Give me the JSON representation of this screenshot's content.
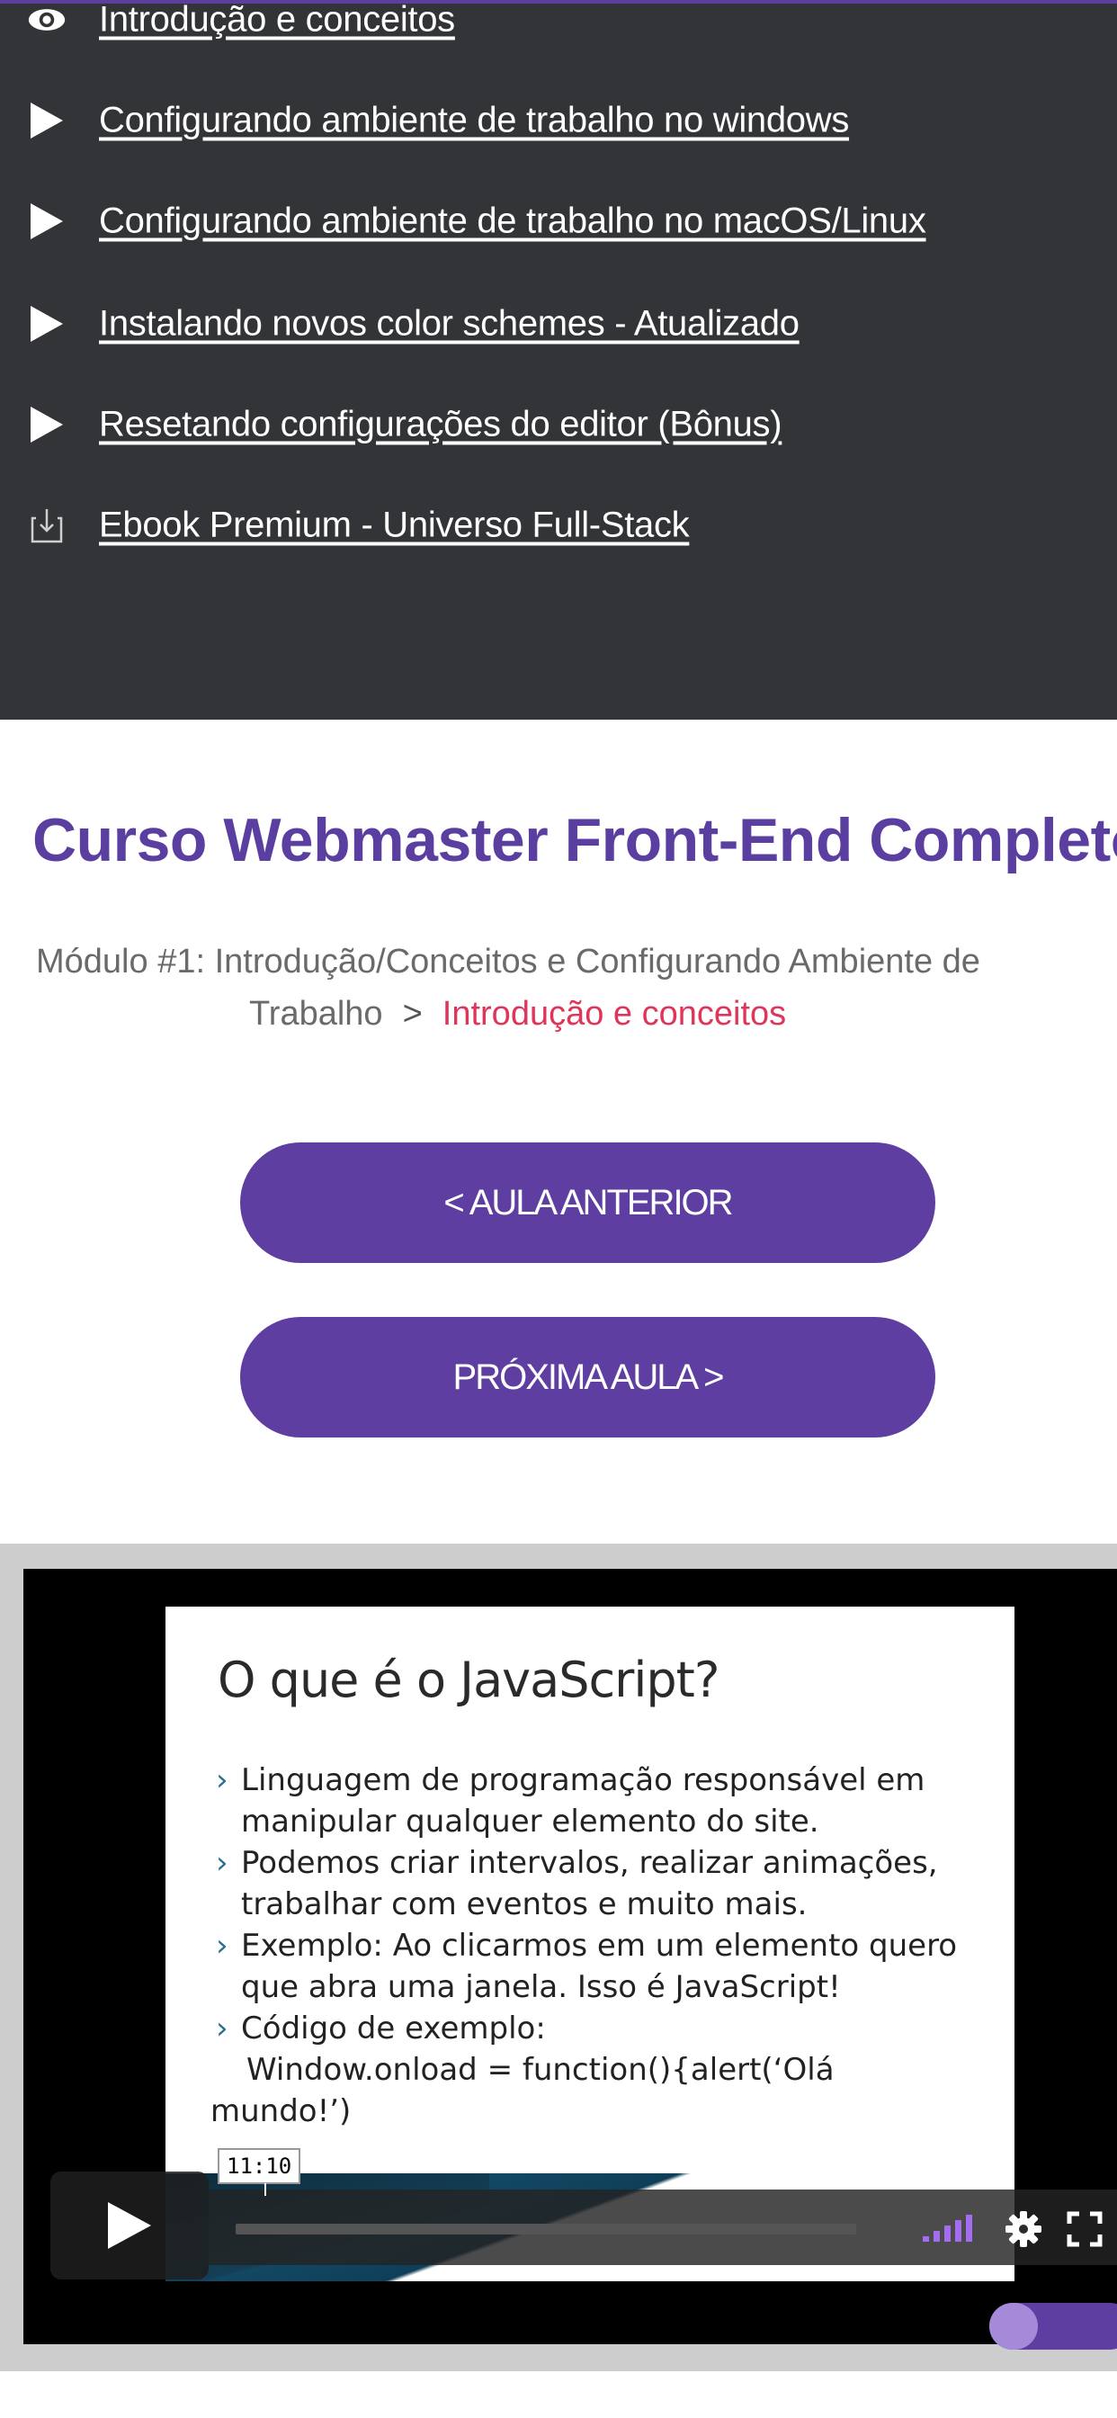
{
  "lessons": [
    {
      "label": "Introdução e conceitos",
      "icon": "eye-icon"
    },
    {
      "label": "Configurando ambiente de trabalho no windows",
      "icon": "play-triangle-icon"
    },
    {
      "label": "Configurando ambiente de trabalho no macOS/Linux",
      "icon": "play-triangle-icon"
    },
    {
      "label": "Instalando novos color schemes - Atualizado",
      "icon": "play-triangle-icon"
    },
    {
      "label": "Resetando configurações do editor (Bônus)",
      "icon": "play-triangle-icon"
    },
    {
      "label": "Ebook Premium - Universo Full-Stack",
      "icon": "download-icon"
    }
  ],
  "course": {
    "title": "Curso Webmaster Front-End Completo",
    "breadcrumb_module_line1": "Módulo #1: Introdução/Conceitos e Configurando Ambiente de",
    "breadcrumb_module_line2": "Trabalho",
    "breadcrumb_separator": ">",
    "breadcrumb_current": "Introdução e conceitos"
  },
  "navigation": {
    "prev_label": "< AULA ANTERIOR",
    "next_label": "PRÓXIMA AULA >"
  },
  "video": {
    "slide_title": "O que é o JavaScript?",
    "bullets": [
      "Linguagem de programação responsável em manipular qualquer elemento do site.",
      "Podemos criar intervalos, realizar animações, trabalhar com eventos e muito mais.",
      "Exemplo: Ao clicarmos em um elemento quero que abra uma janela. Isso é JavaScript!",
      "Código de exemplo:"
    ],
    "code_line1": "Window.onload = function(){alert(‘Olá",
    "code_line2": "mundo!’)",
    "timecode": "11:10",
    "accent_color": "#a46cf0"
  },
  "colors": {
    "brand_purple": "#5e3ea1",
    "highlight_red": "#e0355a",
    "dark_panel": "#333437"
  }
}
